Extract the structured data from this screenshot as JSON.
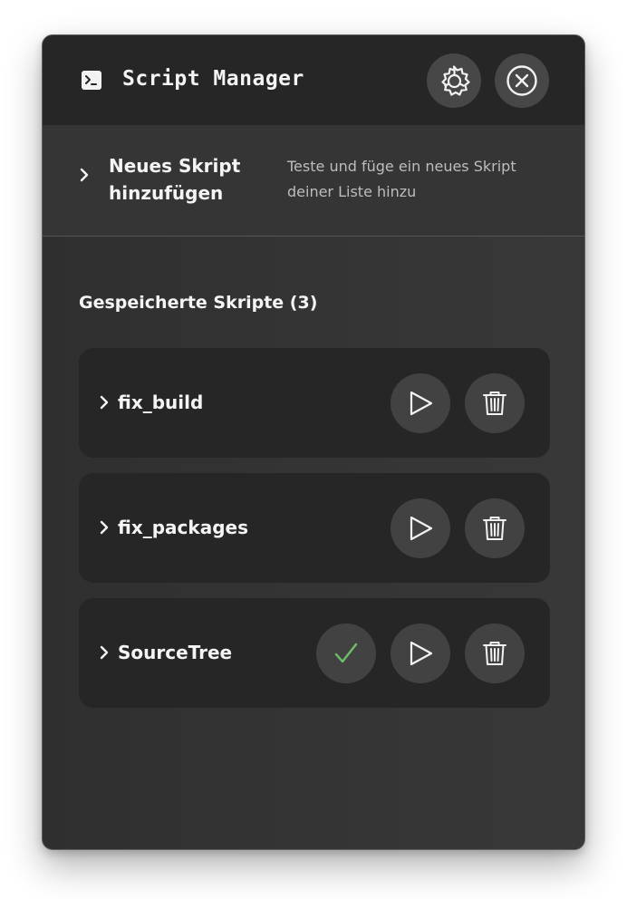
{
  "header": {
    "title": "Script Manager",
    "icons": {
      "app": "terminal-icon",
      "settings": "gear-icon",
      "close": "close-icon"
    }
  },
  "add_script": {
    "title": "Neues Skript hinzufügen",
    "description": "Teste und füge ein neues Skript deiner Liste hinzu"
  },
  "saved": {
    "heading": "Gespeicherte Skripte (3)",
    "scripts": [
      {
        "name": "fix_build",
        "verified": false
      },
      {
        "name": "fix_packages",
        "verified": false
      },
      {
        "name": "SourceTree",
        "verified": true
      }
    ]
  },
  "colors": {
    "check": "#6fbf67",
    "button_bg": "#424242",
    "card_bg": "#262626"
  }
}
